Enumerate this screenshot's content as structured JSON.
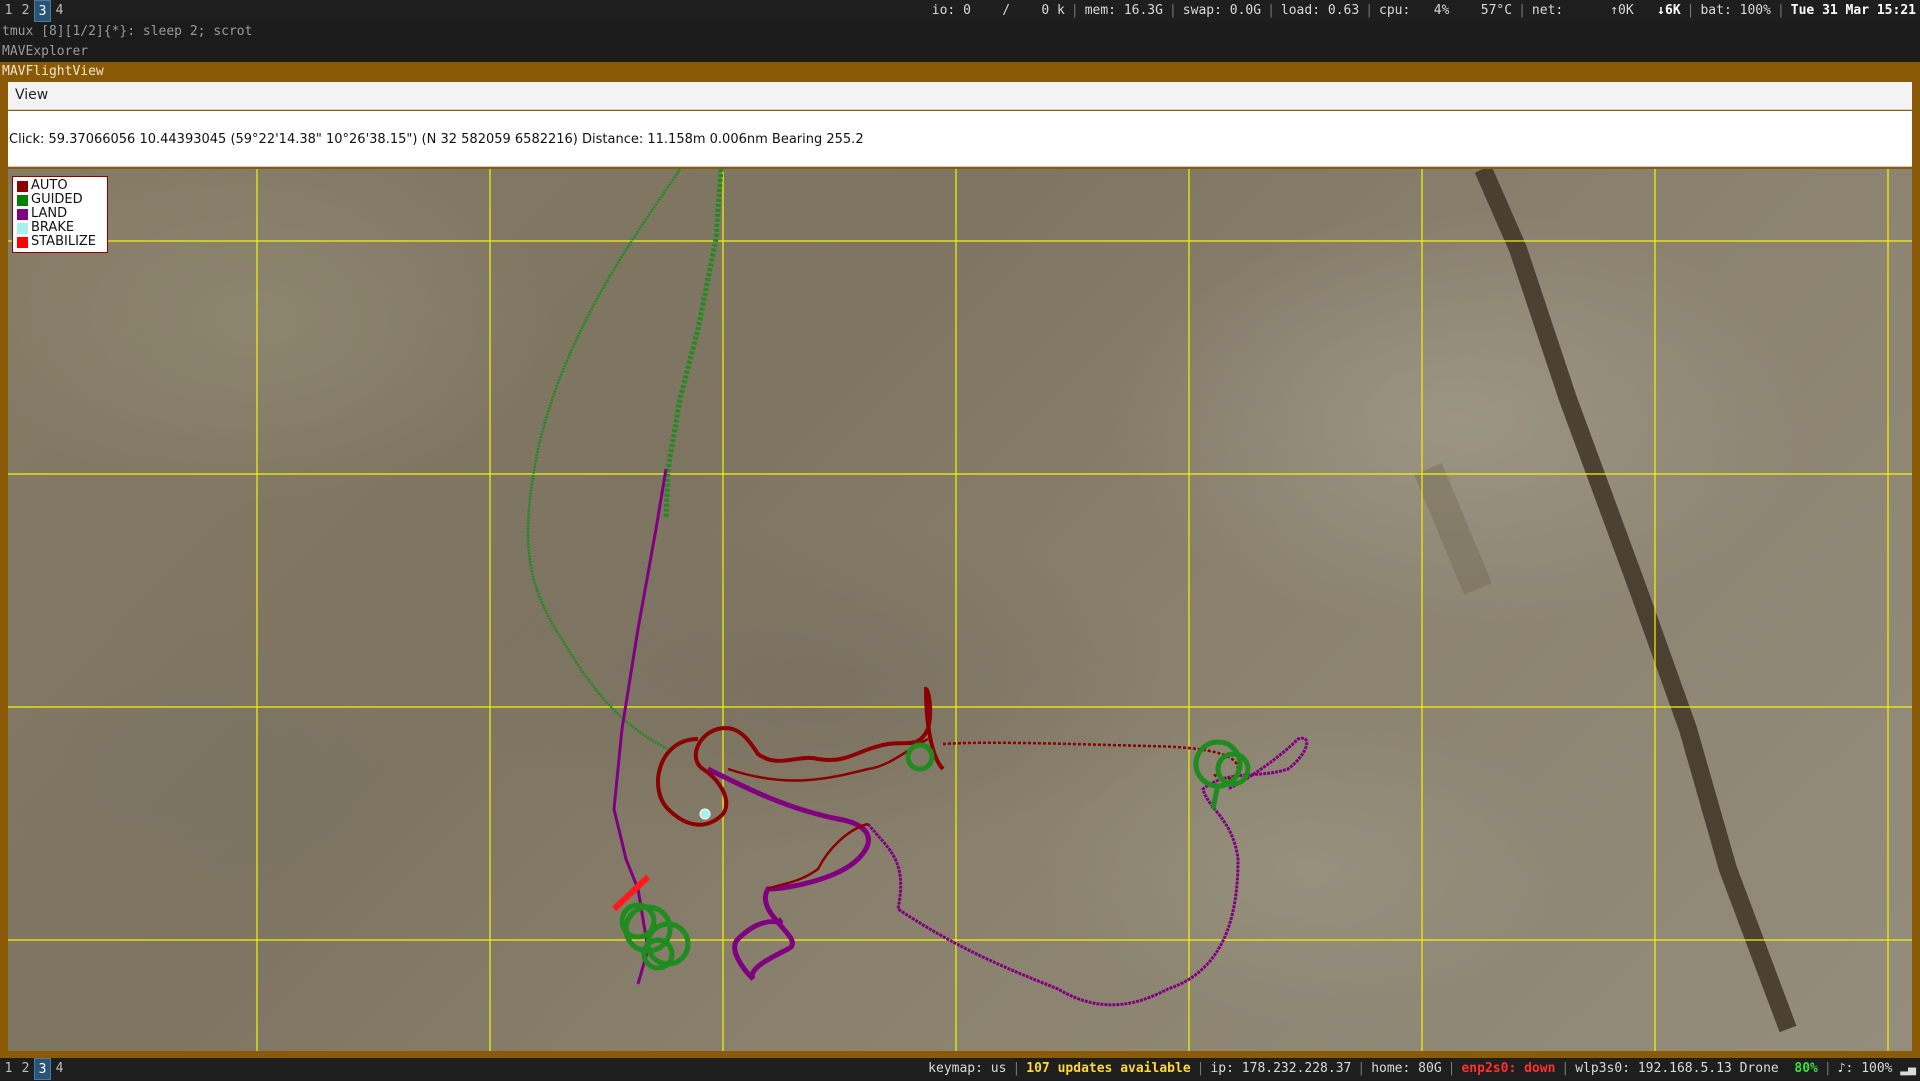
{
  "top_bar": {
    "workspaces": [
      "1",
      "2",
      "3",
      "4"
    ],
    "active_workspace": "3",
    "io": "io: 0",
    "io_slash": "/",
    "io_k": "0 k",
    "mem": "mem: 16.3G",
    "swap": "swap: 0.0G",
    "load": "load: 0.63",
    "cpu": "cpu:   4%",
    "temp": "57°C",
    "net_label": "net:",
    "net_up": "↑0K",
    "net_down": "↓6K",
    "bat": "bat: 100%",
    "datetime": "Tue 31 Mar 15:21"
  },
  "terminal": {
    "line": "tmux [8][1/2]{*}:  sleep 2; scrot"
  },
  "explorer": {
    "title": "MAVExplorer"
  },
  "window": {
    "title": "MAVFlightView"
  },
  "menu": {
    "view": "View"
  },
  "info": {
    "text": "Click: 59.37066056 10.44393045 (59°22'14.38\" 10°26'38.15\") (N 32 582059 6582216)  Distance: 11.158m 0.006nm Bearing 255.2"
  },
  "legend": {
    "items": [
      {
        "label": "AUTO",
        "color": "#8b0000"
      },
      {
        "label": "GUIDED",
        "color": "#008000"
      },
      {
        "label": "LAND",
        "color": "#800080"
      },
      {
        "label": "BRAKE",
        "color": "#a8f0f0"
      },
      {
        "label": "STABILIZE",
        "color": "#ff0000"
      }
    ]
  },
  "colors": {
    "auto": "#8b0000",
    "guided": "#1e8c1e",
    "land": "#800080",
    "stabilize": "#ff1a1a",
    "grid": "#f5f500",
    "window_frame": "#8b5a07"
  },
  "bottom_bar": {
    "workspaces": [
      "1",
      "2",
      "3",
      "4"
    ],
    "active_workspace": "3",
    "keymap": "keymap: us",
    "updates": "107 updates available",
    "ip": "ip: 178.232.228.37",
    "home": "home: 80G",
    "enp": "enp2s0: down",
    "wlp": "wlp3s0: 192.168.5.13",
    "drone": "Drone",
    "drone_pct": "80%",
    "volume": "♪: 100%"
  }
}
